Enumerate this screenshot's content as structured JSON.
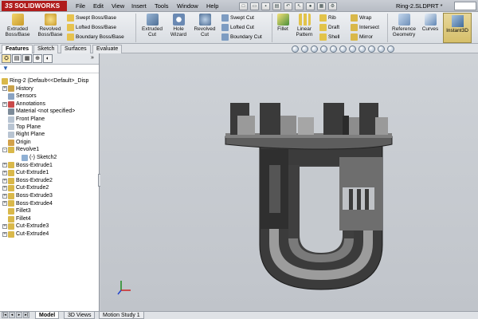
{
  "app": {
    "brand": "SOLIDWORKS",
    "doc_title": "Ring-2.SLDPRT *"
  },
  "menu": [
    "File",
    "Edit",
    "View",
    "Insert",
    "Tools",
    "Window",
    "Help"
  ],
  "ribbon": {
    "big": [
      {
        "label1": "Extruded",
        "label2": "Boss/Base",
        "icon": "extruded-boss-icon"
      },
      {
        "label1": "Revolved",
        "label2": "Boss/Base",
        "icon": "revolved-boss-icon"
      },
      {
        "label1": "Extruded",
        "label2": "Cut",
        "icon": "extruded-cut-icon"
      },
      {
        "label1": "Hole",
        "label2": "Wizard",
        "icon": "hole-wizard-icon"
      },
      {
        "label1": "Revolved",
        "label2": "Cut",
        "icon": "revolved-cut-icon"
      },
      {
        "label1": "Fillet",
        "label2": "",
        "icon": "fillet-icon"
      },
      {
        "label1": "Linear",
        "label2": "Pattern",
        "icon": "linear-pattern-icon"
      },
      {
        "label1": "Reference",
        "label2": "Geometry",
        "icon": "reference-geometry-icon"
      },
      {
        "label1": "Curves",
        "label2": "",
        "icon": "curves-icon"
      },
      {
        "label1": "Instant3D",
        "label2": "",
        "icon": "instant3d-icon"
      }
    ],
    "small": [
      {
        "label": "Swept Boss/Base",
        "icon": "swept-boss-icon"
      },
      {
        "label": "Lofted Boss/Base",
        "icon": "lofted-boss-icon"
      },
      {
        "label": "Boundary Boss/Base",
        "icon": "boundary-boss-icon"
      },
      {
        "label": "Swept Cut",
        "icon": "swept-cut-icon"
      },
      {
        "label": "Lofted Cut",
        "icon": "lofted-cut-icon"
      },
      {
        "label": "Boundary Cut",
        "icon": "boundary-cut-icon"
      },
      {
        "label": "Rib",
        "icon": "rib-icon"
      },
      {
        "label": "Draft",
        "icon": "draft-icon"
      },
      {
        "label": "Shell",
        "icon": "shell-icon"
      },
      {
        "label": "Wrap",
        "icon": "wrap-icon"
      },
      {
        "label": "Intersect",
        "icon": "intersect-icon"
      },
      {
        "label": "Mirror",
        "icon": "mirror-icon"
      }
    ]
  },
  "command_tabs": [
    "Features",
    "Sketch",
    "Surfaces",
    "Evaluate"
  ],
  "feature_tree": {
    "root": "Ring-2  (Default<<Default>_Disp",
    "items": [
      {
        "label": "History",
        "expander": "+",
        "icon": "history-icon"
      },
      {
        "label": "Sensors",
        "expander": "",
        "icon": "sensors-icon"
      },
      {
        "label": "Annotations",
        "expander": "+",
        "icon": "annotations-icon"
      },
      {
        "label": "Material <not specified>",
        "expander": "",
        "icon": "material-icon"
      },
      {
        "label": "Front Plane",
        "expander": "",
        "icon": "plane-icon"
      },
      {
        "label": "Top Plane",
        "expander": "",
        "icon": "plane-icon"
      },
      {
        "label": "Right Plane",
        "expander": "",
        "icon": "plane-icon"
      },
      {
        "label": "Origin",
        "expander": "",
        "icon": "origin-icon"
      },
      {
        "label": "Revolve1",
        "expander": "-",
        "icon": "revolve-feature-icon"
      },
      {
        "label": "(-) Sketch2",
        "expander": "",
        "icon": "sketch-icon"
      },
      {
        "label": "Boss-Extrude1",
        "expander": "+",
        "icon": "extrude-feature-icon"
      },
      {
        "label": "Cut-Extrude1",
        "expander": "+",
        "icon": "cut-feature-icon"
      },
      {
        "label": "Boss-Extrude2",
        "expander": "+",
        "icon": "extrude-feature-icon"
      },
      {
        "label": "Cut-Extrude2",
        "expander": "+",
        "icon": "cut-feature-icon"
      },
      {
        "label": "Boss-Extrude3",
        "expander": "+",
        "icon": "extrude-feature-icon"
      },
      {
        "label": "Boss-Extrude4",
        "expander": "+",
        "icon": "extrude-feature-icon"
      },
      {
        "label": "Fillet3",
        "expander": "",
        "icon": "fillet-feature-icon"
      },
      {
        "label": "Fillet4",
        "expander": "",
        "icon": "fillet-feature-icon"
      },
      {
        "label": "Cut-Extrude3",
        "expander": "+",
        "icon": "cut-feature-icon"
      },
      {
        "label": "Cut-Extrude4",
        "expander": "+",
        "icon": "cut-feature-icon"
      }
    ]
  },
  "bottom_tabs": [
    "Model",
    "3D Views",
    "Motion Study 1"
  ],
  "colors": {
    "brand_red": "#b01c1c",
    "viewport_bg": "#c7cbd0",
    "part_dark": "#3a3a3a",
    "part_mid": "#6f6f6f",
    "part_light": "#a8a8a8"
  }
}
